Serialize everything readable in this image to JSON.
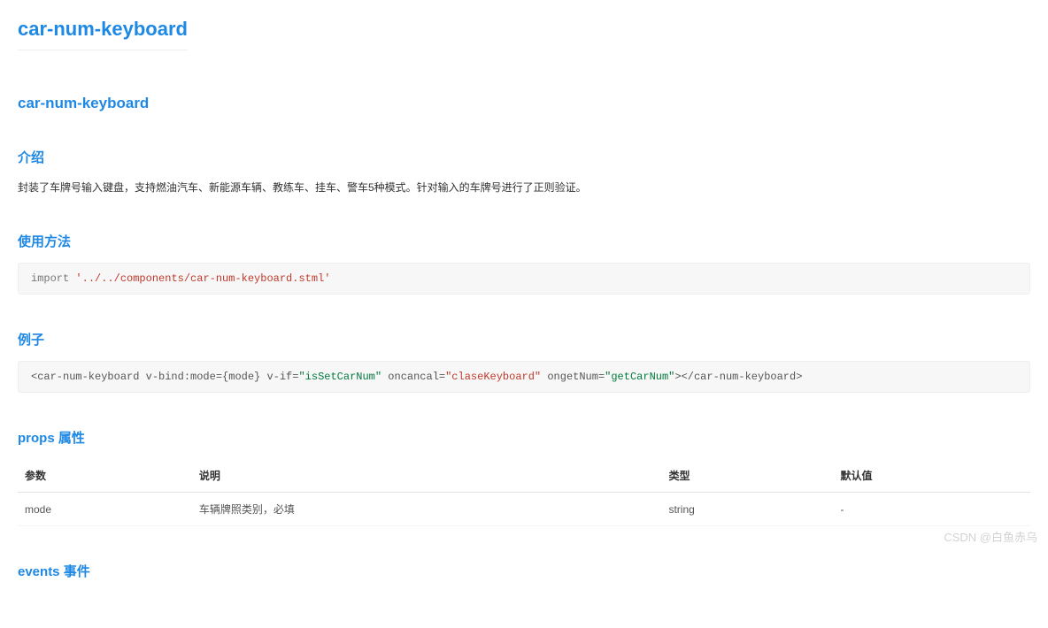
{
  "title": "car-num-keyboard",
  "h2": "car-num-keyboard",
  "intro": {
    "heading": "介绍",
    "text": "封装了车牌号输入键盘，支持燃油汽车、新能源车辆、教练车、挂车、警车5种模式。针对输入的车牌号进行了正则验证。"
  },
  "usage": {
    "heading": "使用方法",
    "code_prefix": "import ",
    "code_string": "'../../components/car-num-keyboard.stml'"
  },
  "example": {
    "heading": "例子",
    "code_parts": {
      "open_tag": "<car-num-keyboard ",
      "attr1": "v-bind:mode={mode} ",
      "attr2_name": "v-if=",
      "attr2_val": "\"isSetCarNum\"",
      "attr3_name": " oncancal=",
      "attr3_val": "\"claseKeyboard\"",
      "attr4_name": " ongetNum=",
      "attr4_val": "\"getCarNum\"",
      "close": "></car-num-keyboard>"
    }
  },
  "props": {
    "heading": "props 属性",
    "columns": [
      "参数",
      "说明",
      "类型",
      "默认值"
    ],
    "rows": [
      {
        "param": "mode",
        "desc": "车辆牌照类别，必填",
        "type": "string",
        "default": "-"
      }
    ]
  },
  "events": {
    "heading": "events 事件"
  },
  "watermark": "CSDN @白鱼赤乌"
}
